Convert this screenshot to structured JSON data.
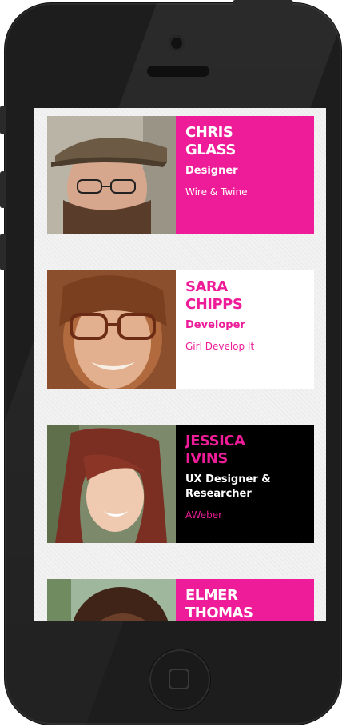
{
  "colors": {
    "pink": "#ee1c98",
    "black": "#000000",
    "white": "#ffffff"
  },
  "people": [
    {
      "first": "CHRIS",
      "last": "GLASS",
      "role": "Designer",
      "company": "Wire & Twine",
      "theme": "pink"
    },
    {
      "first": "SARA",
      "last": "CHIPPS",
      "role": "Developer",
      "company": "Girl Develop It",
      "theme": "white"
    },
    {
      "first": "JESSICA",
      "last": "IVINS",
      "role": "UX Designer & Researcher",
      "company": "AWeber",
      "theme": "black"
    },
    {
      "first": "ELMER",
      "last": "THOMAS",
      "role": "",
      "company": "",
      "theme": "pink"
    }
  ]
}
